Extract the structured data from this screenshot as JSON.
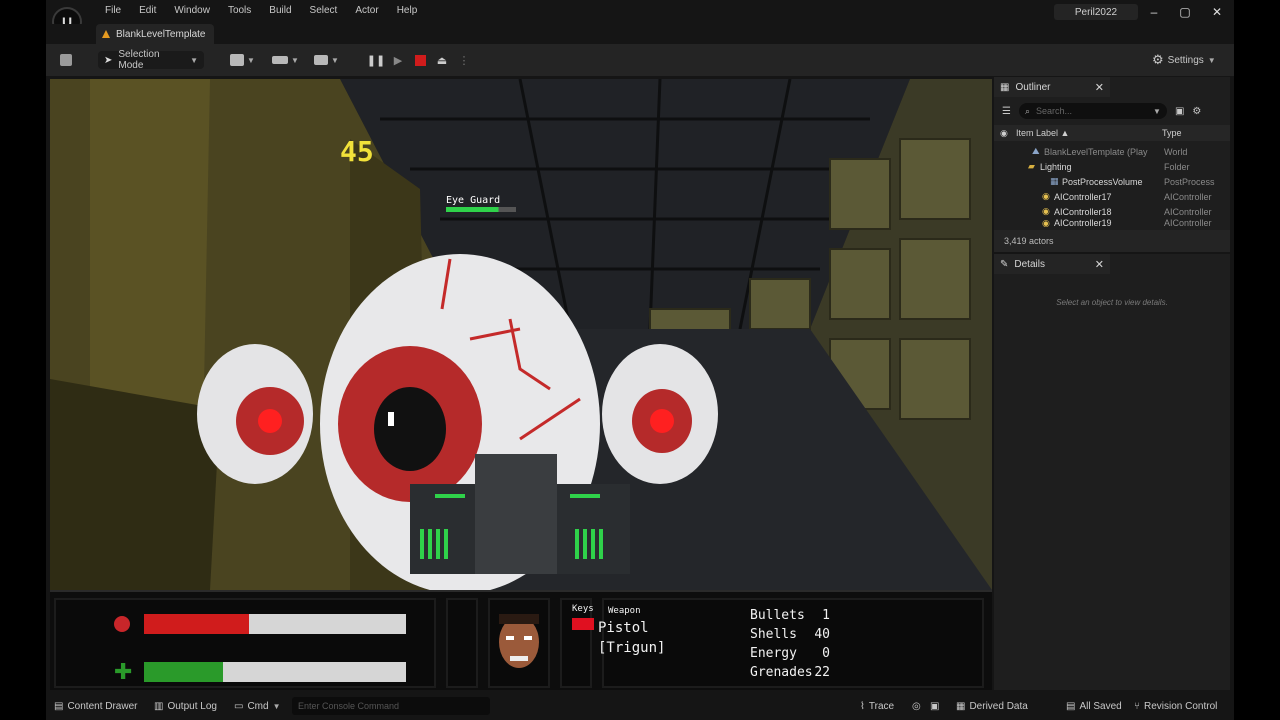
{
  "menu": [
    "File",
    "Edit",
    "Window",
    "Tools",
    "Build",
    "Select",
    "Actor",
    "Help"
  ],
  "project_name": "Peril2022",
  "level_tab": "BlankLevelTemplate",
  "toolbar": {
    "selection_mode": "Selection Mode",
    "settings": "Settings"
  },
  "game": {
    "ammo_counter": "45",
    "enemy_name": "Eye Guard",
    "enemy_health": 0.75,
    "armor_level": 0.4,
    "health_level": 0.3,
    "keys_label": "Keys",
    "weapon_label": "Weapon",
    "weapon_name": "Pistol",
    "weapon_sub": "[Trigun]",
    "ammo": [
      {
        "name": "Bullets",
        "count": "1"
      },
      {
        "name": "Shells",
        "count": "40"
      },
      {
        "name": "Energy",
        "count": "0"
      },
      {
        "name": "Grenades",
        "count": "22"
      }
    ]
  },
  "outliner": {
    "tab": "Outliner",
    "search_placeholder": "Search...",
    "col_label": "Item Label ▲",
    "col_type": "Type",
    "rows": [
      {
        "label": "BlankLevelTemplate (Play",
        "type": "World"
      },
      {
        "label": "Lighting",
        "type": "Folder"
      },
      {
        "label": "PostProcessVolume",
        "type": "PostProcess"
      },
      {
        "label": "AIController17",
        "type": "AIController"
      },
      {
        "label": "AIController18",
        "type": "AIController"
      },
      {
        "label": "AIController19",
        "type": "AIController"
      }
    ],
    "footer": "3,419 actors"
  },
  "details": {
    "tab": "Details",
    "empty": "Select an object to view details."
  },
  "statusbar": {
    "content_drawer": "Content Drawer",
    "output_log": "Output Log",
    "cmd": "Cmd",
    "console_placeholder": "Enter Console Command",
    "trace": "Trace",
    "derived_data": "Derived Data",
    "all_saved": "All Saved",
    "revision_control": "Revision Control"
  },
  "colors": {
    "accent_red": "#d01c1c",
    "accent_green": "#2a9a2a",
    "hud_yellow": "#f2e23a"
  }
}
